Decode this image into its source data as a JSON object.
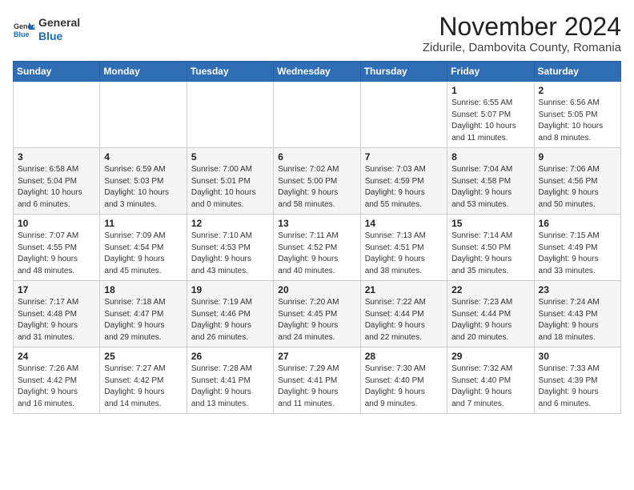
{
  "header": {
    "logo_general": "General",
    "logo_blue": "Blue",
    "month_title": "November 2024",
    "location": "Zidurile, Dambovita County, Romania"
  },
  "days_of_week": [
    "Sunday",
    "Monday",
    "Tuesday",
    "Wednesday",
    "Thursday",
    "Friday",
    "Saturday"
  ],
  "weeks": [
    [
      {
        "day": "",
        "info": ""
      },
      {
        "day": "",
        "info": ""
      },
      {
        "day": "",
        "info": ""
      },
      {
        "day": "",
        "info": ""
      },
      {
        "day": "",
        "info": ""
      },
      {
        "day": "1",
        "info": "Sunrise: 6:55 AM\nSunset: 5:07 PM\nDaylight: 10 hours\nand 11 minutes."
      },
      {
        "day": "2",
        "info": "Sunrise: 6:56 AM\nSunset: 5:05 PM\nDaylight: 10 hours\nand 8 minutes."
      }
    ],
    [
      {
        "day": "3",
        "info": "Sunrise: 6:58 AM\nSunset: 5:04 PM\nDaylight: 10 hours\nand 6 minutes."
      },
      {
        "day": "4",
        "info": "Sunrise: 6:59 AM\nSunset: 5:03 PM\nDaylight: 10 hours\nand 3 minutes."
      },
      {
        "day": "5",
        "info": "Sunrise: 7:00 AM\nSunset: 5:01 PM\nDaylight: 10 hours\nand 0 minutes."
      },
      {
        "day": "6",
        "info": "Sunrise: 7:02 AM\nSunset: 5:00 PM\nDaylight: 9 hours\nand 58 minutes."
      },
      {
        "day": "7",
        "info": "Sunrise: 7:03 AM\nSunset: 4:59 PM\nDaylight: 9 hours\nand 55 minutes."
      },
      {
        "day": "8",
        "info": "Sunrise: 7:04 AM\nSunset: 4:58 PM\nDaylight: 9 hours\nand 53 minutes."
      },
      {
        "day": "9",
        "info": "Sunrise: 7:06 AM\nSunset: 4:56 PM\nDaylight: 9 hours\nand 50 minutes."
      }
    ],
    [
      {
        "day": "10",
        "info": "Sunrise: 7:07 AM\nSunset: 4:55 PM\nDaylight: 9 hours\nand 48 minutes."
      },
      {
        "day": "11",
        "info": "Sunrise: 7:09 AM\nSunset: 4:54 PM\nDaylight: 9 hours\nand 45 minutes."
      },
      {
        "day": "12",
        "info": "Sunrise: 7:10 AM\nSunset: 4:53 PM\nDaylight: 9 hours\nand 43 minutes."
      },
      {
        "day": "13",
        "info": "Sunrise: 7:11 AM\nSunset: 4:52 PM\nDaylight: 9 hours\nand 40 minutes."
      },
      {
        "day": "14",
        "info": "Sunrise: 7:13 AM\nSunset: 4:51 PM\nDaylight: 9 hours\nand 38 minutes."
      },
      {
        "day": "15",
        "info": "Sunrise: 7:14 AM\nSunset: 4:50 PM\nDaylight: 9 hours\nand 35 minutes."
      },
      {
        "day": "16",
        "info": "Sunrise: 7:15 AM\nSunset: 4:49 PM\nDaylight: 9 hours\nand 33 minutes."
      }
    ],
    [
      {
        "day": "17",
        "info": "Sunrise: 7:17 AM\nSunset: 4:48 PM\nDaylight: 9 hours\nand 31 minutes."
      },
      {
        "day": "18",
        "info": "Sunrise: 7:18 AM\nSunset: 4:47 PM\nDaylight: 9 hours\nand 29 minutes."
      },
      {
        "day": "19",
        "info": "Sunrise: 7:19 AM\nSunset: 4:46 PM\nDaylight: 9 hours\nand 26 minutes."
      },
      {
        "day": "20",
        "info": "Sunrise: 7:20 AM\nSunset: 4:45 PM\nDaylight: 9 hours\nand 24 minutes."
      },
      {
        "day": "21",
        "info": "Sunrise: 7:22 AM\nSunset: 4:44 PM\nDaylight: 9 hours\nand 22 minutes."
      },
      {
        "day": "22",
        "info": "Sunrise: 7:23 AM\nSunset: 4:44 PM\nDaylight: 9 hours\nand 20 minutes."
      },
      {
        "day": "23",
        "info": "Sunrise: 7:24 AM\nSunset: 4:43 PM\nDaylight: 9 hours\nand 18 minutes."
      }
    ],
    [
      {
        "day": "24",
        "info": "Sunrise: 7:26 AM\nSunset: 4:42 PM\nDaylight: 9 hours\nand 16 minutes."
      },
      {
        "day": "25",
        "info": "Sunrise: 7:27 AM\nSunset: 4:42 PM\nDaylight: 9 hours\nand 14 minutes."
      },
      {
        "day": "26",
        "info": "Sunrise: 7:28 AM\nSunset: 4:41 PM\nDaylight: 9 hours\nand 13 minutes."
      },
      {
        "day": "27",
        "info": "Sunrise: 7:29 AM\nSunset: 4:41 PM\nDaylight: 9 hours\nand 11 minutes."
      },
      {
        "day": "28",
        "info": "Sunrise: 7:30 AM\nSunset: 4:40 PM\nDaylight: 9 hours\nand 9 minutes."
      },
      {
        "day": "29",
        "info": "Sunrise: 7:32 AM\nSunset: 4:40 PM\nDaylight: 9 hours\nand 7 minutes."
      },
      {
        "day": "30",
        "info": "Sunrise: 7:33 AM\nSunset: 4:39 PM\nDaylight: 9 hours\nand 6 minutes."
      }
    ]
  ]
}
